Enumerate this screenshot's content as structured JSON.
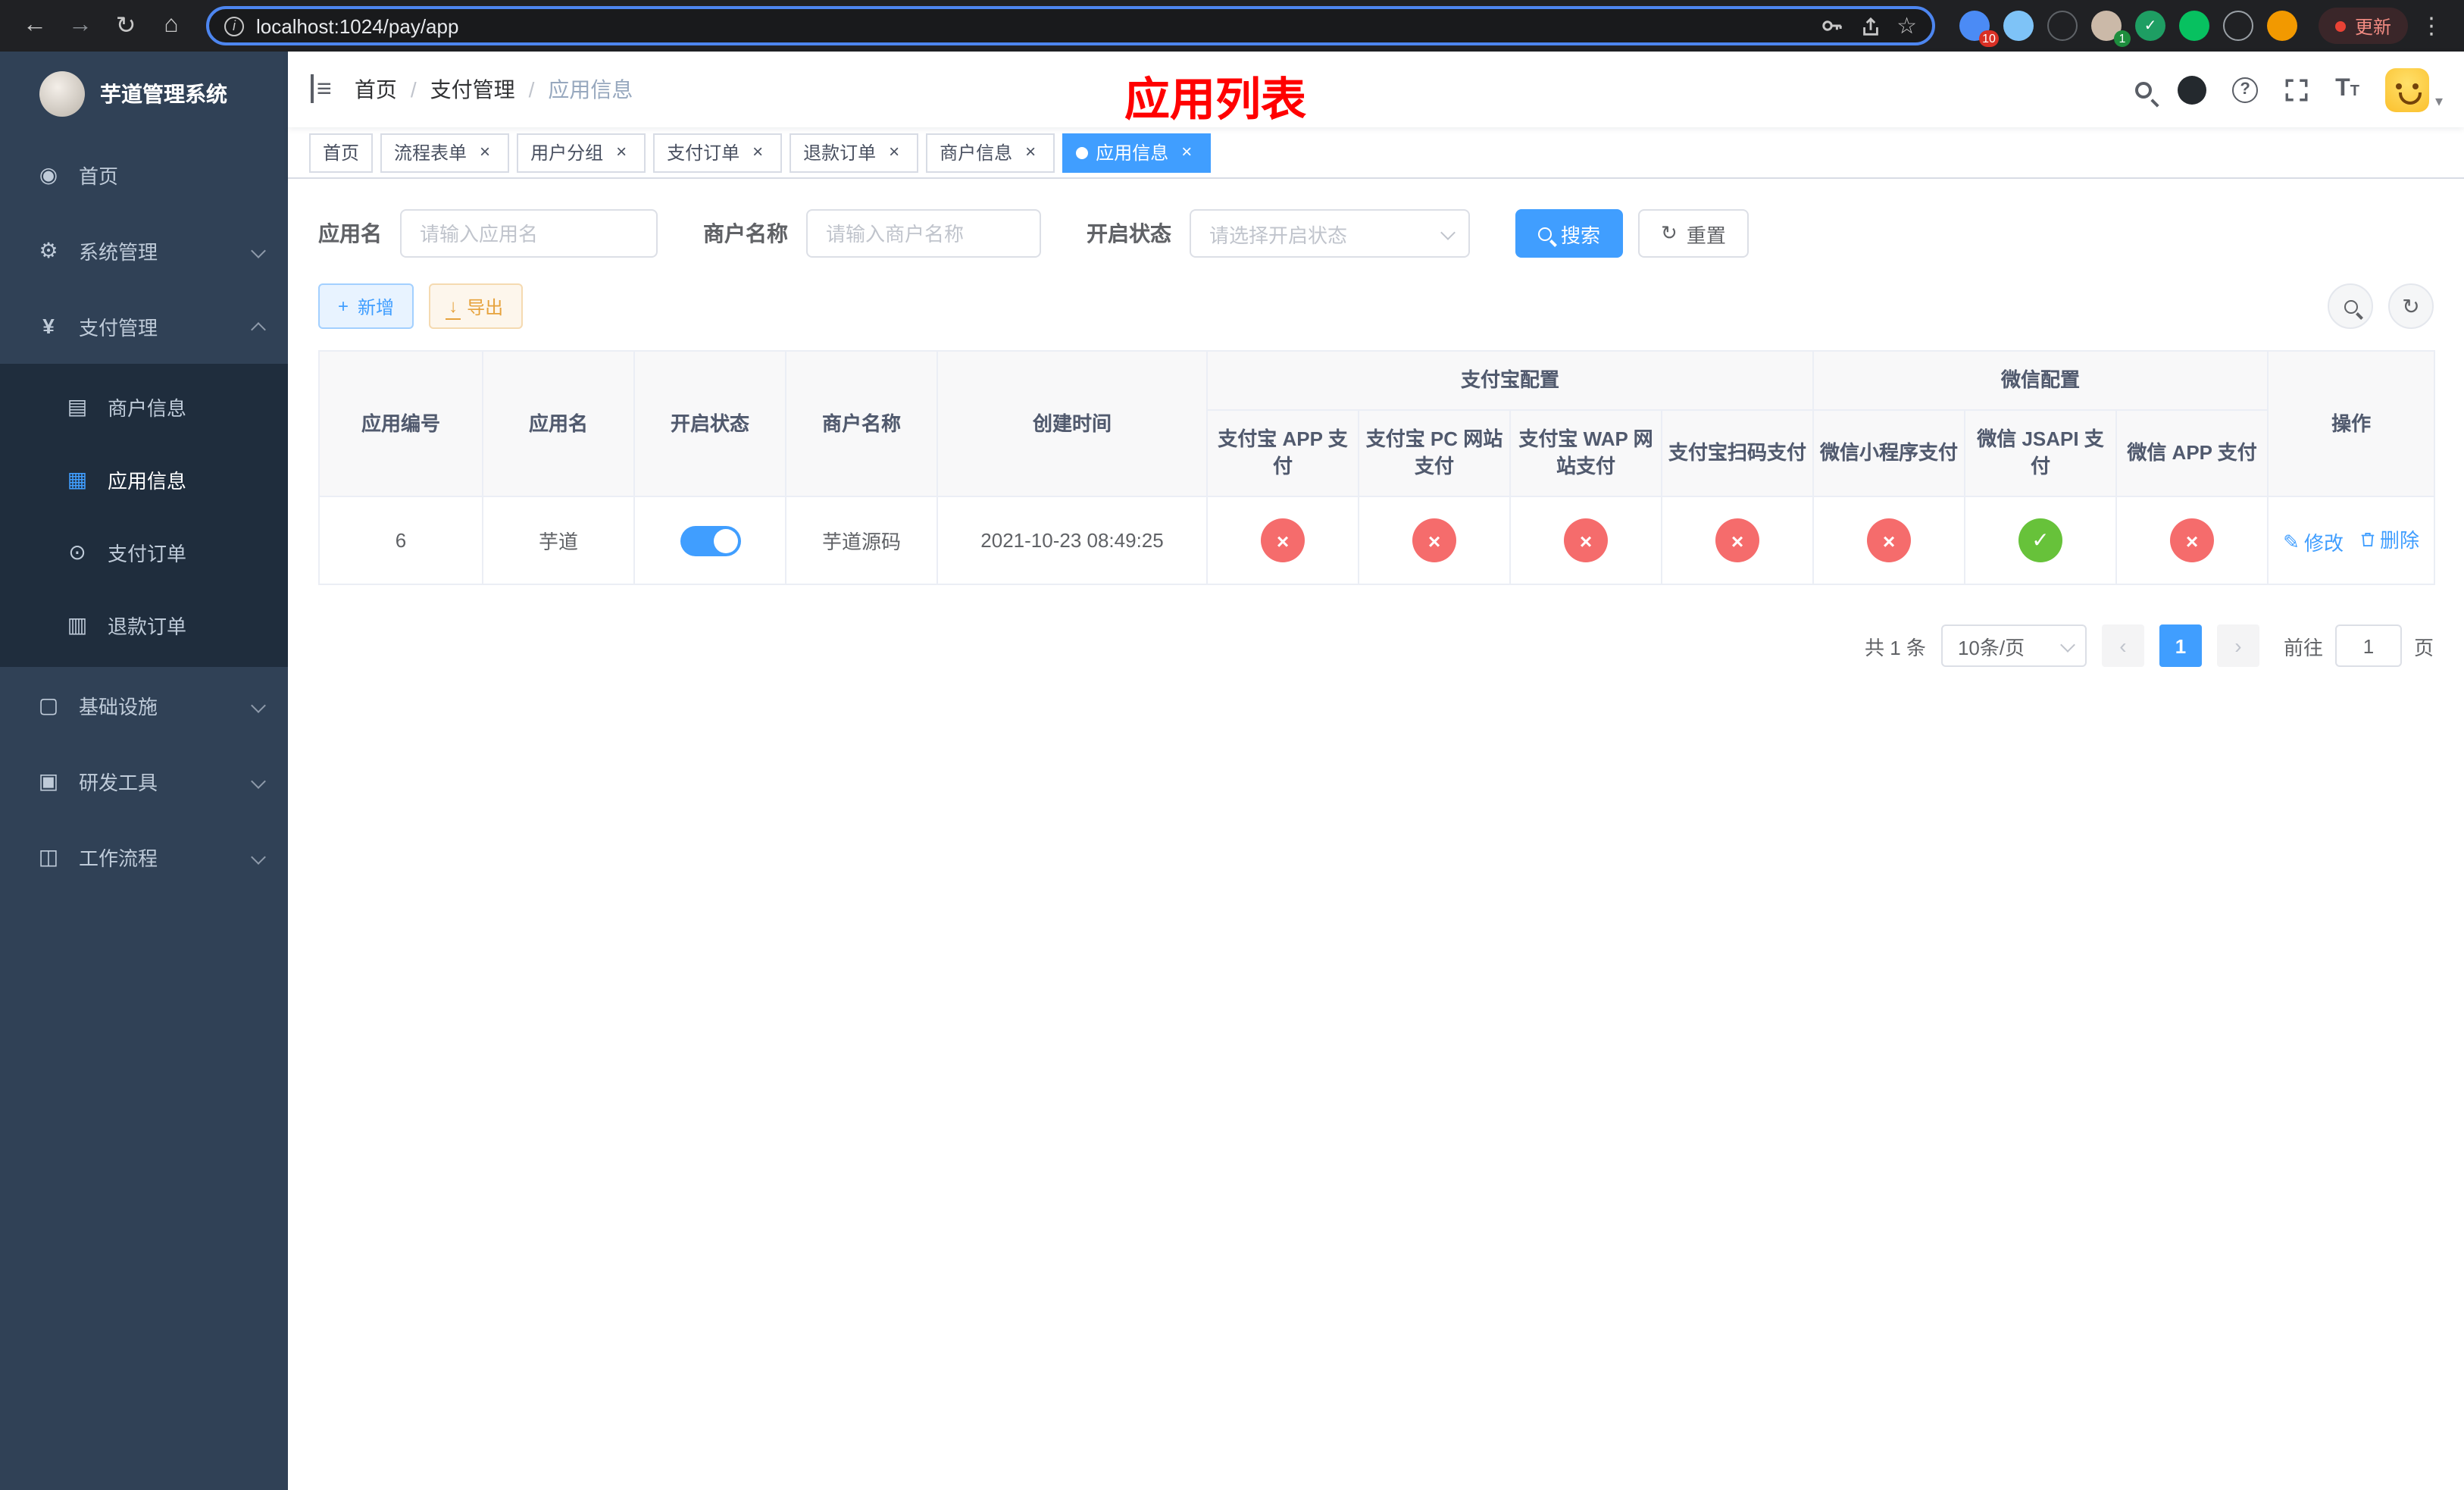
{
  "browser": {
    "url": "localhost:1024/pay/app",
    "update_label": "更新",
    "extension_badge": "10",
    "profile_badge": "1"
  },
  "icons": {
    "back": "←",
    "forward": "→",
    "reload": "↻",
    "home": "⌂",
    "info": "i",
    "star": "☆",
    "kebab": "⋮",
    "check": "✓",
    "cross": "×",
    "close": "×",
    "prev": "‹",
    "next": "›",
    "plus": "+",
    "download": "↓",
    "refresh": "↻",
    "menu_fold": "≡",
    "question": "?",
    "sep": "/",
    "dashboard": "◉",
    "gear": "⚙",
    "yen": "¥",
    "card": "▤",
    "grid": "▦",
    "order": "⊙",
    "refund": "▥",
    "infra": "▢",
    "tool": "▣",
    "flow": "◫",
    "pencil": "✎",
    "size_big": "T",
    "size_small": "T"
  },
  "sidebar": {
    "logo_title": "芋道管理系统",
    "items": [
      {
        "label": "首页"
      },
      {
        "label": "系统管理"
      },
      {
        "label": "支付管理"
      },
      {
        "label": "基础设施"
      },
      {
        "label": "研发工具"
      },
      {
        "label": "工作流程"
      }
    ],
    "payment_children": [
      {
        "label": "商户信息"
      },
      {
        "label": "应用信息"
      },
      {
        "label": "支付订单"
      },
      {
        "label": "退款订单"
      }
    ]
  },
  "header": {
    "breadcrumb": [
      "首页",
      "支付管理",
      "应用信息"
    ],
    "page_title": "应用列表"
  },
  "tabs": [
    {
      "label": "首页"
    },
    {
      "label": "流程表单"
    },
    {
      "label": "用户分组"
    },
    {
      "label": "支付订单"
    },
    {
      "label": "退款订单"
    },
    {
      "label": "商户信息"
    },
    {
      "label": "应用信息"
    }
  ],
  "filters": {
    "app_name_label": "应用名",
    "app_name_placeholder": "请输入应用名",
    "merchant_label": "商户名称",
    "merchant_placeholder": "请输入商户名称",
    "status_label": "开启状态",
    "status_placeholder": "请选择开启状态",
    "search_label": "搜索",
    "reset_label": "重置"
  },
  "toolbar": {
    "add_label": "新增",
    "export_label": "导出"
  },
  "table": {
    "groups": {
      "alipay": "支付宝配置",
      "wechat": "微信配置"
    },
    "base_columns": [
      "应用编号",
      "应用名",
      "开启状态",
      "商户名称",
      "创建时间"
    ],
    "alipay_columns": [
      "支付宝 APP 支付",
      "支付宝 PC 网站支付",
      "支付宝 WAP 网站支付",
      "支付宝扫码支付"
    ],
    "wechat_columns": [
      "微信小程序支付",
      "微信 JSAPI 支付",
      "微信 APP 支付"
    ],
    "ops_column": "操作",
    "rows": [
      {
        "id": "6",
        "name": "芋道",
        "enabled": true,
        "merchant": "芋道源码",
        "created_at": "2021-10-23 08:49:25",
        "statuses": [
          false,
          false,
          false,
          false,
          false,
          true,
          false
        ],
        "edit_label": "修改",
        "delete_label": "删除"
      }
    ]
  },
  "pagination": {
    "total_label": "共 1 条",
    "page_size_label": "10条/页",
    "current_page": "1",
    "goto_label": "前往",
    "goto_value": "1",
    "page_unit_label": "页"
  },
  "colors": {
    "accent": "#409eff",
    "success": "#67c23a",
    "danger": "#f56c6c",
    "warning": "#e6a23c",
    "sidebar_bg": "#304156",
    "title_red": "#ff0000"
  }
}
